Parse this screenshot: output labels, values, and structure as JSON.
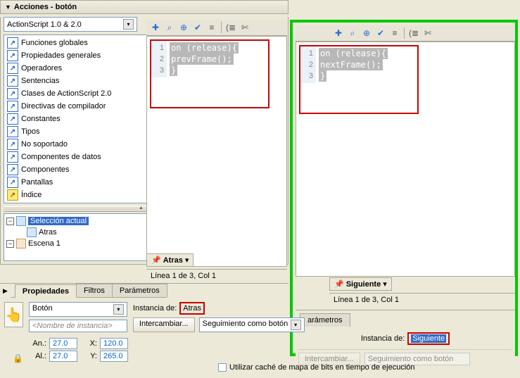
{
  "panel_title": "Acciones - botón",
  "script_version": "ActionScript 1.0 & 2.0",
  "tree_items": [
    "Funciones globales",
    "Propiedades generales",
    "Operadores",
    "Sentencias",
    "Clases de ActionScript 2.0",
    "Directivas de compilador",
    "Constantes",
    "Tipos",
    "No soportado",
    "Componentes de datos",
    "Componentes",
    "Pantallas",
    "Índice"
  ],
  "selection_panel": {
    "current": "Selección actual",
    "item": "Atras",
    "scene": "Escena 1"
  },
  "left_editor": {
    "code": [
      "on (release){",
      "prevFrame();",
      "}"
    ],
    "tab": "Atras",
    "status": "Línea 1 de 3, Col 1"
  },
  "right_editor": {
    "code": [
      "on (release){",
      "nextFrame();",
      "}"
    ],
    "tab": "Siguiente",
    "status": "Línea 1 de 3, Col 1"
  },
  "props": {
    "tabs": [
      "Propiedades",
      "Filtros",
      "Parámetros"
    ],
    "type": "Botón",
    "name_placeholder": "<Nombre de instancia>",
    "swap": "Intercambiar...",
    "instance_label": "Instancia de:",
    "instance_left": "Atras",
    "instance_right": "Siguiente",
    "track": "Seguimiento como botón",
    "an": "An.:",
    "an_v": "27.0",
    "al": "Al.:",
    "al_v": "27.0",
    "x": "X:",
    "x_v": "120.0",
    "y": "Y:",
    "y_v": "265.0",
    "cache": "Utilizar caché de mapa de bits en tiempo de ejecución"
  },
  "right_tab_label": "arámetros",
  "right_swap": "Intercambiar...",
  "right_track": "Seguimiento como botón"
}
